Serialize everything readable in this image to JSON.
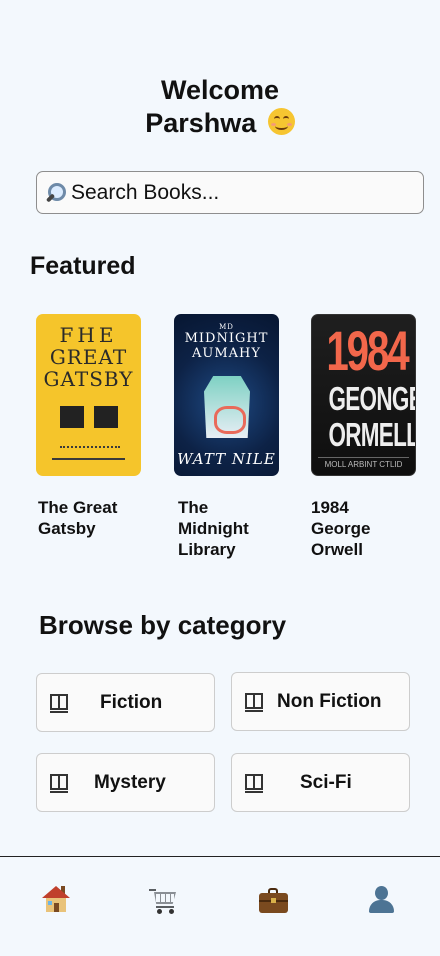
{
  "greeting": {
    "line1": "Welcome",
    "line2": "Parshwa",
    "emoji": "smiling-face-icon"
  },
  "search": {
    "placeholder": "Search Books...",
    "icon": "magnifier-icon"
  },
  "featured": {
    "title": "Featured",
    "books": [
      {
        "name": "The Great Gatsby",
        "cover_lines": [
          "FHE",
          "GREAT",
          "GATSBY"
        ],
        "cover_color": "#f5c52b"
      },
      {
        "name": "The Midnight Library",
        "cover_top": "MD",
        "cover_lines": [
          "MIDNIGHT",
          "AUMAHY"
        ],
        "cover_author": "WATT NILE",
        "cover_color": "#0d2246"
      },
      {
        "name": "1984 George Orwell",
        "cover_lines": [
          "1984",
          "GEONGE",
          "ORMELL"
        ],
        "cover_sub": "MOLL ARBINT CTLID",
        "cover_color": "#141414"
      }
    ]
  },
  "browse": {
    "title": "Browse by category",
    "categories": [
      {
        "label": "Fiction",
        "icon": "book-icon"
      },
      {
        "label": "Non Fiction",
        "icon": "book-icon"
      },
      {
        "label": "Mystery",
        "icon": "book-icon"
      },
      {
        "label": "Sci-Fi",
        "icon": "book-icon"
      }
    ]
  },
  "bottom_nav": [
    {
      "icon": "home-icon"
    },
    {
      "icon": "cart-icon"
    },
    {
      "icon": "briefcase-icon"
    },
    {
      "icon": "profile-icon"
    }
  ]
}
